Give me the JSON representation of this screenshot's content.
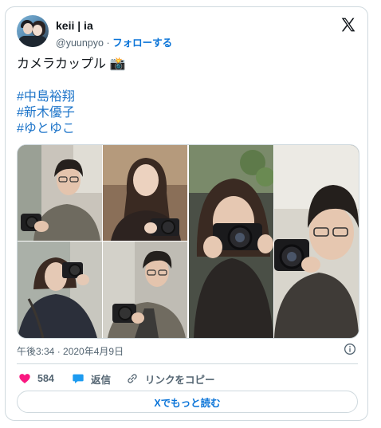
{
  "author": {
    "display_name": "keii | ia",
    "handle": "@yuunpyo",
    "separator": "·",
    "follow_label": "フォローする"
  },
  "tweet": {
    "text": "カメラカップル 📸",
    "hashtags": [
      "#中島裕翔",
      "#新木優子",
      "#ゆとゆこ"
    ],
    "timestamp": "午後3:34 · 2020年4月9日"
  },
  "actions": {
    "like_count": "584",
    "reply_label": "返信",
    "copy_link_label": "リンクをコピー",
    "read_more_label": "Xでもっと読む"
  },
  "colors": {
    "link": "#1d74c9",
    "like": "#f91880",
    "reply": "#1d9bf0",
    "border": "#cfd9de",
    "muted": "#536471"
  },
  "icons": [
    "x-logo-icon",
    "info-icon",
    "heart-icon",
    "reply-bubble-icon",
    "link-icon"
  ]
}
